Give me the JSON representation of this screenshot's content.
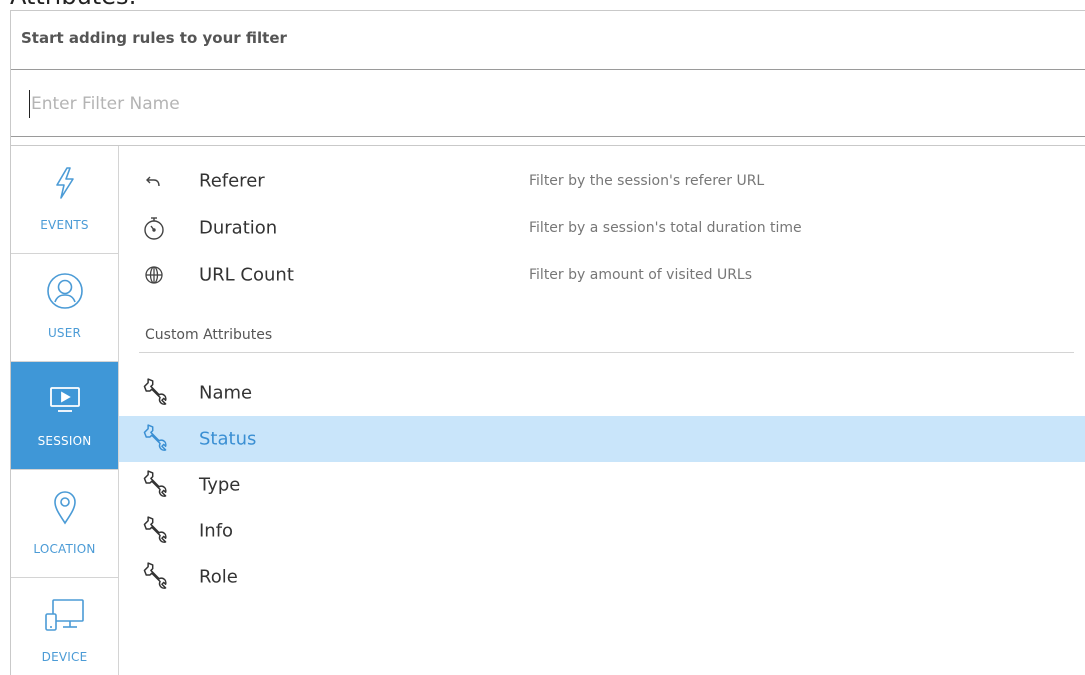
{
  "header": {
    "cut_title": "Attributes:",
    "subtitle": "Start adding rules to your filter"
  },
  "filter_name": {
    "value": "",
    "placeholder": "Enter Filter Name"
  },
  "sidebar": {
    "items": [
      {
        "label": "EVENTS",
        "icon": "lightning-icon",
        "active": false
      },
      {
        "label": "USER",
        "icon": "user-icon",
        "active": false
      },
      {
        "label": "SESSION",
        "icon": "monitor-play-icon",
        "active": true
      },
      {
        "label": "LOCATION",
        "icon": "location-pin-icon",
        "active": false
      },
      {
        "label": "DEVICE",
        "icon": "devices-icon",
        "active": false
      }
    ]
  },
  "session_rules": [
    {
      "label": "Referer",
      "icon": "referer-arrow-icon",
      "description": "Filter by the session's referer URL"
    },
    {
      "label": "Duration",
      "icon": "stopwatch-icon",
      "description": "Filter by a session's total duration time"
    },
    {
      "label": "URL Count",
      "icon": "globe-icon",
      "description": "Filter by amount of visited URLs"
    }
  ],
  "custom_attributes": {
    "title": "Custom Attributes",
    "items": [
      {
        "label": "Name",
        "icon": "wrench-icon",
        "selected": false
      },
      {
        "label": "Status",
        "icon": "wrench-icon",
        "selected": true
      },
      {
        "label": "Type",
        "icon": "wrench-icon",
        "selected": false
      },
      {
        "label": "Info",
        "icon": "wrench-icon",
        "selected": false
      },
      {
        "label": "Role",
        "icon": "wrench-icon",
        "selected": false
      }
    ]
  },
  "colors": {
    "accent": "#3f97d7",
    "selected_row": "#c9e5fa",
    "selected_text": "#3a8fd3"
  }
}
